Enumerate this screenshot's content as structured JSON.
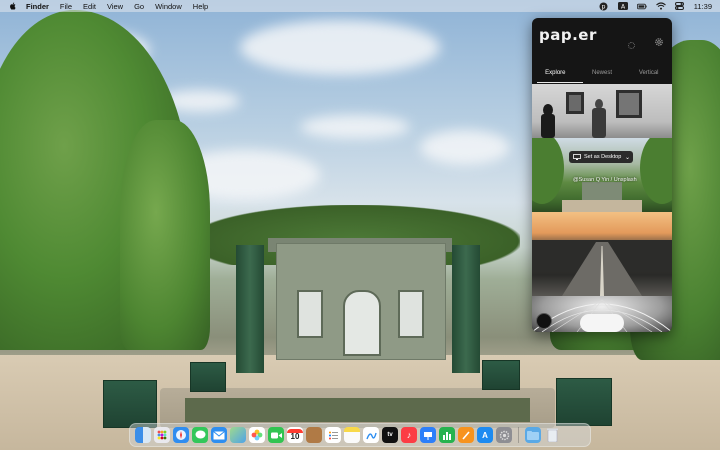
{
  "menubar": {
    "app_name": "Finder",
    "menus": [
      "File",
      "Edit",
      "View",
      "Go",
      "Window",
      "Help"
    ],
    "clock": "11:39"
  },
  "paper": {
    "logo": "pap.er",
    "tabs": [
      "Explore",
      "Newest",
      "Vertical"
    ],
    "active_tab": "Explore",
    "set_desktop_label": "Set as Desktop",
    "photo_credit": "@Susan Q Yin / Unsplash"
  },
  "dock": {
    "calendar_day": "10",
    "apps": [
      "Finder",
      "Launchpad",
      "Safari",
      "Messages",
      "Mail",
      "Maps",
      "Photos",
      "FaceTime",
      "Calendar",
      "Notes-brown",
      "Reminders",
      "Notes",
      "Freeform",
      "TV",
      "Music",
      "Keynote",
      "Numbers",
      "Pages",
      "App Store",
      "System Settings",
      "Downloads",
      "Trash"
    ]
  },
  "colors": {
    "popover_bg": "#151515",
    "accent_text": "#ffffff"
  }
}
